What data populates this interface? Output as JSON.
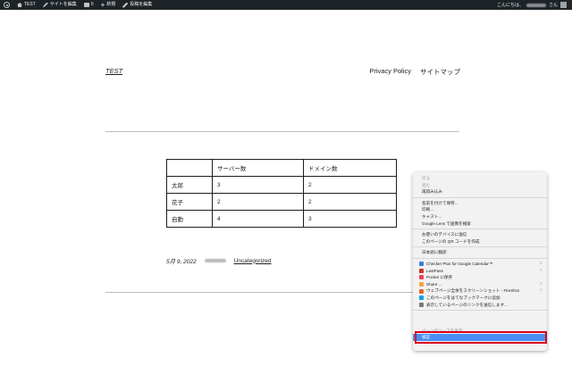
{
  "adminbar": {
    "site_name": "TEST",
    "customize": "サイトを編集",
    "comments_count": "0",
    "new_label": "新規",
    "edit_post": "投稿を編集",
    "greeting": "こんにちは、",
    "greeting_suffix": "さん"
  },
  "header": {
    "site_title": "TEST",
    "nav": [
      "Privacy Policy",
      "サイトマップ"
    ]
  },
  "table": {
    "headers": [
      "",
      "サーバー数",
      "ドメイン数"
    ],
    "rows": [
      [
        "太郎",
        "3",
        "2"
      ],
      [
        "花子",
        "2",
        "2"
      ],
      [
        "自動",
        "4",
        "3"
      ]
    ]
  },
  "post_meta": {
    "date": "5月 9, 2022",
    "category": "Uncategorized"
  },
  "context_menu": {
    "items": [
      "戻る",
      "進む",
      "再読み込み",
      "名前を付けて保存...",
      "印刷...",
      "キャスト...",
      "Google Lens で画像を検索",
      "お使いのデバイスに送信",
      "このページの QR コードを作成",
      "日本語に翻訳",
      "Checker Plus for Google Calendar™",
      "LastPass",
      "Pocket に保存",
      "Share ...",
      "ウェブページ全体をスクリーンショット - FireShot",
      "このページをはてなブックマークに追加",
      "表示しているページのリンクを送信します...",
      "ページのソースを表示",
      "検証"
    ]
  },
  "colors": {
    "adminbar_bg": "#1d2327",
    "highlight": "#4a8ef5",
    "annotation_red": "#d9001b"
  }
}
